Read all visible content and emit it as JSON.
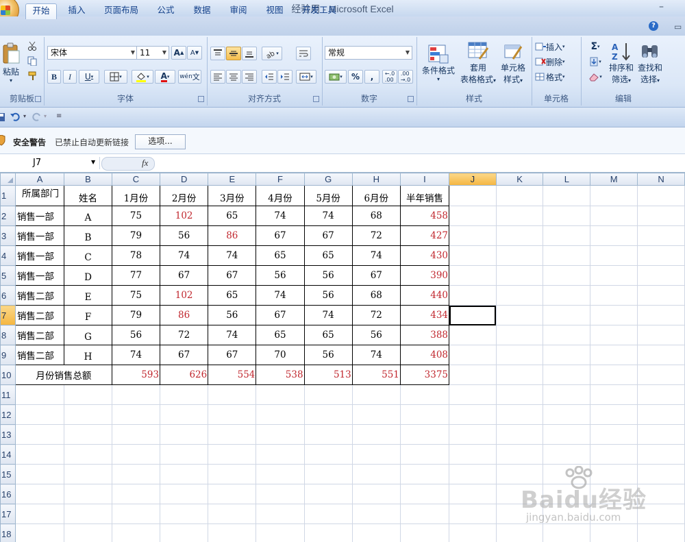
{
  "window": {
    "title": "经验用 - Microsoft Excel",
    "minimize": "–"
  },
  "tabs": [
    "开始",
    "插入",
    "页面布局",
    "公式",
    "数据",
    "审阅",
    "视图",
    "开发工具"
  ],
  "ribbon": {
    "clipboard": {
      "label": "剪贴板",
      "paste": "粘贴"
    },
    "font": {
      "label": "字体",
      "font_name": "宋体",
      "font_size": "11",
      "bold": "B",
      "italic": "I",
      "underline": "U",
      "grow": "A",
      "shrink": "A",
      "font_color_letter": "A",
      "phonetic": "wén"
    },
    "alignment": {
      "label": "对齐方式"
    },
    "number": {
      "label": "数字",
      "format": "常规",
      "percent": "%",
      "comma": ","
    },
    "styles": {
      "label": "样式",
      "conditional": "条件格式",
      "table_format_1": "套用",
      "table_format_2": "表格格式",
      "cell_style_1": "单元格",
      "cell_style_2": "样式"
    },
    "cells": {
      "label": "单元格",
      "insert": "插入",
      "delete": "删除",
      "format": "格式"
    },
    "editing": {
      "label": "编辑",
      "sort_1": "排序和",
      "sort_2": "筛选",
      "find_1": "查找和",
      "find_2": "选择",
      "sigma": "Σ"
    }
  },
  "security": {
    "title": "安全警告",
    "message": "已禁止自动更新链接",
    "options_button": "选项..."
  },
  "formula_bar": {
    "name_box": "J7",
    "fx": "fx",
    "value": ""
  },
  "columns": [
    "A",
    "B",
    "C",
    "D",
    "E",
    "F",
    "G",
    "H",
    "I",
    "J",
    "K",
    "L",
    "M",
    "N"
  ],
  "selected_column": "J",
  "selected_row": "7",
  "row_numbers": [
    "1",
    "2",
    "3",
    "4",
    "5",
    "6",
    "7",
    "8",
    "9",
    "10",
    "11",
    "12",
    "13",
    "14",
    "15",
    "16",
    "17",
    "18"
  ],
  "sheet": {
    "headers": [
      "所属部门",
      "姓名",
      "1月份",
      "2月份",
      "3月份",
      "4月份",
      "5月份",
      "6月份",
      "半年销售"
    ],
    "rows": [
      [
        "销售一部",
        "A",
        "75",
        "102",
        "65",
        "74",
        "74",
        "68",
        "458"
      ],
      [
        "销售一部",
        "B",
        "79",
        "56",
        "86",
        "67",
        "67",
        "72",
        "427"
      ],
      [
        "销售一部",
        "C",
        "78",
        "74",
        "74",
        "65",
        "65",
        "74",
        "430"
      ],
      [
        "销售一部",
        "D",
        "77",
        "67",
        "67",
        "56",
        "56",
        "67",
        "390"
      ],
      [
        "销售二部",
        "E",
        "75",
        "102",
        "65",
        "74",
        "56",
        "68",
        "440"
      ],
      [
        "销售二部",
        "F",
        "79",
        "86",
        "56",
        "67",
        "74",
        "72",
        "434"
      ],
      [
        "销售二部",
        "G",
        "56",
        "72",
        "74",
        "65",
        "65",
        "56",
        "388"
      ],
      [
        "销售二部",
        "H",
        "74",
        "67",
        "67",
        "70",
        "56",
        "74",
        "408"
      ]
    ],
    "total_label": "月份销售总额",
    "totals": [
      "593",
      "626",
      "554",
      "538",
      "513",
      "551",
      "3375"
    ],
    "red_cells": [
      "D2",
      "E3",
      "D6",
      "D7"
    ]
  },
  "watermark": {
    "text": "Baidu经验",
    "url": "jingyan.baidu.com"
  }
}
